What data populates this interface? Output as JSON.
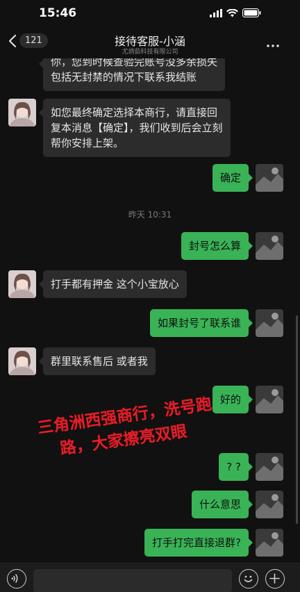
{
  "status": {
    "time": "15:46"
  },
  "nav": {
    "back_count": "121",
    "title": "接待客服-小涵",
    "subtitle": "尤炳茹科技有限公司",
    "more_icon": "more-icon"
  },
  "messages": {
    "m0_line1": "你，您到时候查验完账号没多余损失",
    "m0_line2": "包括无封禁的情况下联系我结账",
    "m1_line1": "如您最终确定选择本商行，请直接回",
    "m1_line2": "复本消息【确定】，我们收到后会立刻",
    "m1_line3": "帮你安排上架。",
    "m2": "确定",
    "time_divider": "昨天 10:31",
    "m3": "封号怎么算",
    "m4": "打手都有押金 这个小宝放心",
    "m5": "如果封号了联系谁",
    "m6": "群里联系售后 或者我",
    "m7": "好的",
    "m8": "? ?",
    "m9": "什么意思",
    "m10": "打手打完直接退群?"
  },
  "overlay": {
    "line1": "三角洲西强商行，洗号跑",
    "line2": "路，大家擦亮双眼",
    "color": "#e0202a"
  },
  "colors": {
    "outgoing_bubble": "#39b356",
    "incoming_bubble": "#2c2c2c",
    "background": "#111111"
  },
  "input_bar": {
    "voice_icon": "voice-icon",
    "emoji_icon": "emoji-icon",
    "plus_icon": "plus-icon"
  }
}
